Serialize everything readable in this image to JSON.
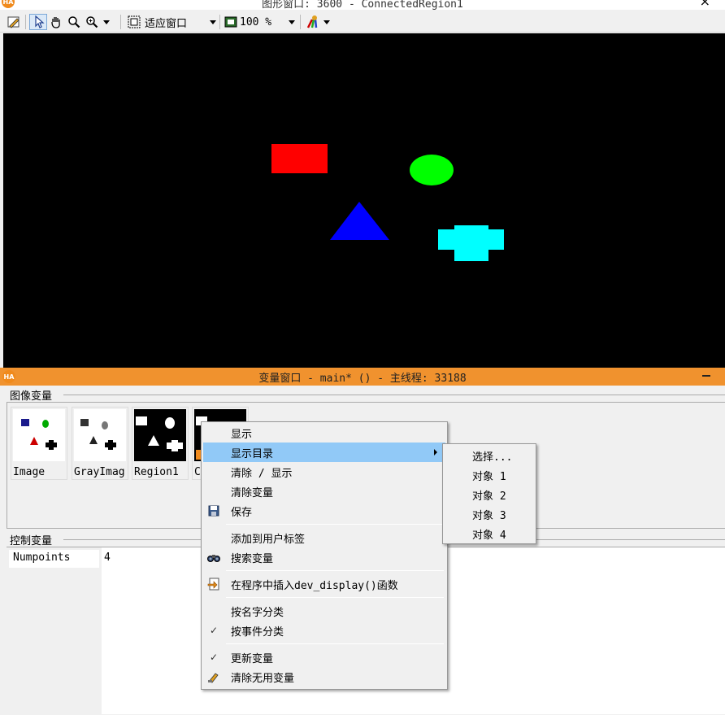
{
  "graphics_window": {
    "title": "图形窗口: 3600 - ConnectedRegion1",
    "close": "×",
    "logo": "HA",
    "toolbar": {
      "fit_label": "适应窗口",
      "zoom_label": "100 %"
    }
  },
  "canvas_shapes": [
    {
      "name": "red-rectangle",
      "color": "#ff0000"
    },
    {
      "name": "green-ellipse",
      "color": "#00ff00"
    },
    {
      "name": "blue-triangle",
      "color": "#0000ff"
    },
    {
      "name": "cyan-cross",
      "color": "#00ffff"
    }
  ],
  "variable_window": {
    "title": "变量窗口 - main* () - 主线程: 33188",
    "logo": "HA",
    "image_section_label": "图像变量",
    "control_section_label": "控制变量",
    "thumbnails": [
      {
        "label": "Image"
      },
      {
        "label": "GrayImag"
      },
      {
        "label": "Region1"
      },
      {
        "label": "C"
      }
    ],
    "controls": [
      {
        "name": "Numpoints",
        "value": "4"
      }
    ]
  },
  "context_menu": {
    "items": [
      {
        "label": "显示"
      },
      {
        "label": "显示目录"
      },
      {
        "label": "清除 / 显示"
      },
      {
        "label": "清除变量"
      },
      {
        "label": "保存"
      },
      {
        "label": "添加到用户标签"
      },
      {
        "label": "搜索变量"
      },
      {
        "label": "在程序中插入dev_display()函数"
      },
      {
        "label": "按名字分类"
      },
      {
        "label": "按事件分类"
      },
      {
        "label": "更新变量"
      },
      {
        "label": "清除无用变量"
      }
    ],
    "check_mark": "✓"
  },
  "submenu": {
    "items": [
      {
        "label": "选择..."
      },
      {
        "label": "对象 1"
      },
      {
        "label": "对象 2"
      },
      {
        "label": "对象 3"
      },
      {
        "label": "对象 4"
      }
    ]
  },
  "colors": {
    "variable_title_bar": "#f0922e",
    "menu_highlight": "#91c9f7",
    "canvas_background": "#000000"
  }
}
